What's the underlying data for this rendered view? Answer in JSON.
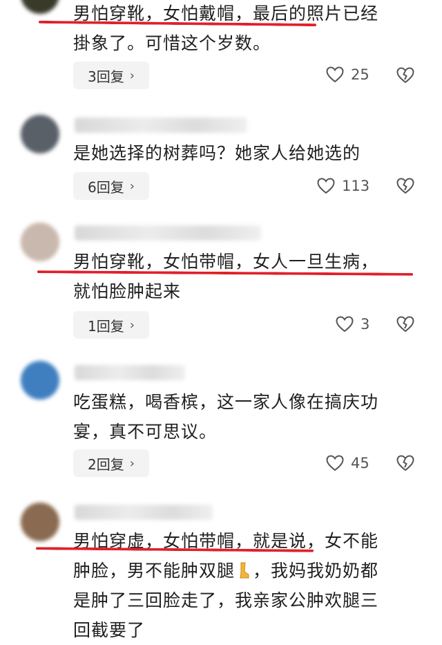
{
  "comments": [
    {
      "text": "男怕穿靴，女怕戴帽，最后的照片已经\n掛象了。可惜这个岁数。",
      "reply_label": "3回复",
      "likes": "25",
      "avatar_color": "#3a3a2a"
    },
    {
      "text": "是她选择的树葬吗？她家人给她选的",
      "reply_label": "6回复",
      "likes": "113",
      "avatar_color": "#5a6068"
    },
    {
      "text": "男怕穿靴，女怕带帽，女人一旦生病，\n就怕脸肿起来",
      "reply_label": "1回复",
      "likes": "3",
      "avatar_color": "#c9b8ad"
    },
    {
      "text": "吃蛋糕，喝香槟，这一家人像在搞庆功\n宴，真不可思议。",
      "reply_label": "2回复",
      "likes": "45",
      "avatar_color": "#3f7fc0"
    },
    {
      "text_line1": "男怕穿虚，女怕带帽，就是说，女不能",
      "text_line2a": "肿脸，男不能肿双腿",
      "text_line2b": "，我妈我奶奶都",
      "text_line3": "是肿了三回脸走了，我亲家公肿欢腿三",
      "text_line4": "回截要了",
      "avatar_color": "#8a6a50"
    }
  ],
  "colors": {
    "underline": "#e0202a",
    "reply_bg": "#f3f3f3"
  }
}
